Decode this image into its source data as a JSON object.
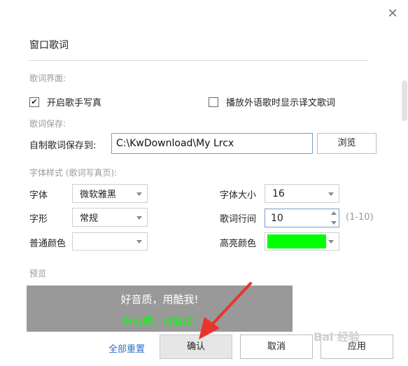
{
  "dialog": {
    "title": "窗口歌词",
    "close_glyph": "✕"
  },
  "sections": {
    "lyrics_ui": "歌词界面:",
    "lyrics_save": "歌词保存:",
    "font_style": "字体样式 (歌词写真页):",
    "preview": "预览"
  },
  "options": {
    "enable_photo": {
      "label": "开启歌手写真",
      "checked": true,
      "mark": "✔"
    },
    "show_translation": {
      "label": "播放外语歌时显示译文歌词",
      "checked": false,
      "mark": ""
    }
  },
  "save": {
    "label": "自制歌词保存到:",
    "path": "C:\\KwDownload\\My Lrcx",
    "browse_label": "浏览"
  },
  "font": {
    "font_label": "字体",
    "font_value": "微软雅黑",
    "size_label": "字体大小",
    "size_value": "16",
    "style_label": "字形",
    "style_value": "常规",
    "line_spacing_label": "歌词行间",
    "line_spacing_value": "10",
    "line_spacing_range": "(1-10)",
    "normal_color_label": "普通颜色",
    "normal_color_value": "#ffffff",
    "highlight_color_label": "高亮颜色",
    "highlight_color_value": "#00ff00"
  },
  "preview": {
    "line1": "好音质，用酷我!",
    "line2": "好音质，用酷我!",
    "line1_color": "#ffffff",
    "line2_color": "#00ff00",
    "bg_color": "#999999"
  },
  "footer": {
    "reset_label": "全部重置",
    "confirm_label": "确认",
    "cancel_label": "取消",
    "apply_label": "应用"
  },
  "watermark": {
    "text": "Bai 经验"
  },
  "icons": {
    "close": "close-icon",
    "caret": "chevron-down-icon",
    "spin_up": "chevron-up-icon",
    "spin_down": "chevron-down-icon",
    "pointer_arrow": "red-arrow-icon"
  },
  "colors": {
    "accent_link": "#2a6fc9",
    "arrow": "#e8352b"
  }
}
